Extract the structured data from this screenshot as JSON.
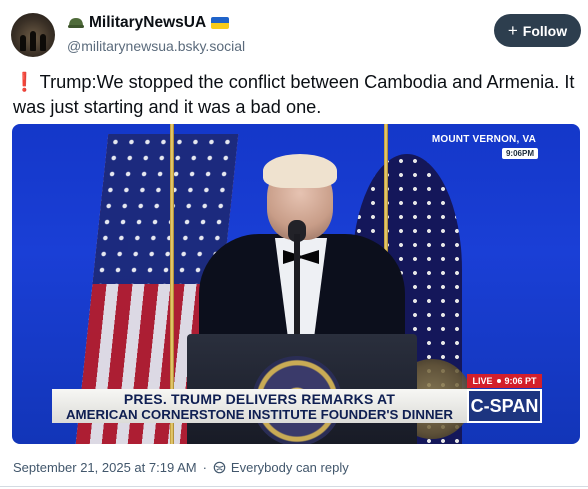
{
  "author": {
    "display_name": "MilitaryNewsUA",
    "handle": "@militarynewsua.bsky.social",
    "name_icons": [
      "helmet-icon",
      "ukraine-flag-icon"
    ]
  },
  "follow_button": {
    "label": "Follow",
    "icon": "plus-icon"
  },
  "post": {
    "prefix_icon": "exclamation-icon",
    "prefix_glyph": "❗",
    "text": "Trump:We stopped the conflict between Cambodia and Armenia. It was just starting and it was a bad one."
  },
  "video": {
    "location": "MOUNT VERNON, VA",
    "time_badge": "9:06PM",
    "live_label": "LIVE",
    "live_time": "9:06 PT",
    "network": "C-SPAN",
    "caption_line1": "PRES. TRUMP DELIVERS REMARKS AT",
    "caption_line2": "AMERICAN CORNERSTONE INSTITUTE FOUNDER'S DINNER"
  },
  "footer": {
    "date": "September 21, 2025 at 7:19 AM",
    "reply_setting": "Everybody can reply",
    "reply_icon": "globe-icon"
  },
  "colors": {
    "follow_bg": "#2d3e4e",
    "video_bg": "#1a3fd6",
    "cspan_blue": "#1d3580",
    "live_red": "#d31f2b",
    "muted_text": "#5b6b7c"
  }
}
